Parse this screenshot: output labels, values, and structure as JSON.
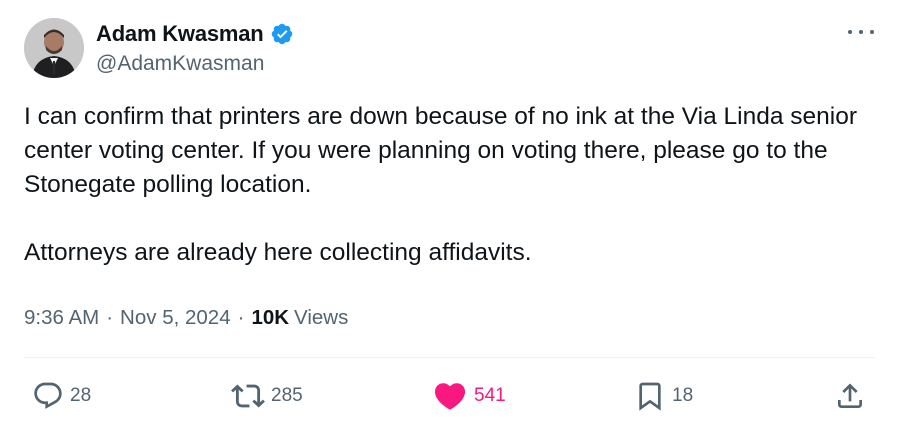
{
  "author": {
    "display_name": "Adam Kwasman",
    "handle": "@AdamKwasman",
    "verified": true,
    "verified_color": "#1d9bf0"
  },
  "tweet": {
    "paragraphs": [
      "I can confirm that printers are down because of no ink at the Via Linda senior center voting center. If you were planning on voting there, please go to the Stonegate polling location.",
      "Attorneys are already here collecting affidavits."
    ],
    "time": "9:36 AM",
    "date": "Nov 5, 2024",
    "views_count": "10K",
    "views_label": "Views",
    "meta_separator": "·"
  },
  "actions": {
    "reply": {
      "icon": "reply-icon",
      "count": "28"
    },
    "repost": {
      "icon": "repost-icon",
      "count": "285"
    },
    "like": {
      "icon": "heart-icon",
      "count": "541",
      "active": true,
      "color": "#f91880"
    },
    "bookmark": {
      "icon": "bookmark-icon",
      "count": "18"
    },
    "share": {
      "icon": "share-icon"
    }
  },
  "colors": {
    "text_primary": "#0f1419",
    "text_secondary": "#536471",
    "divider": "#eff3f4"
  }
}
